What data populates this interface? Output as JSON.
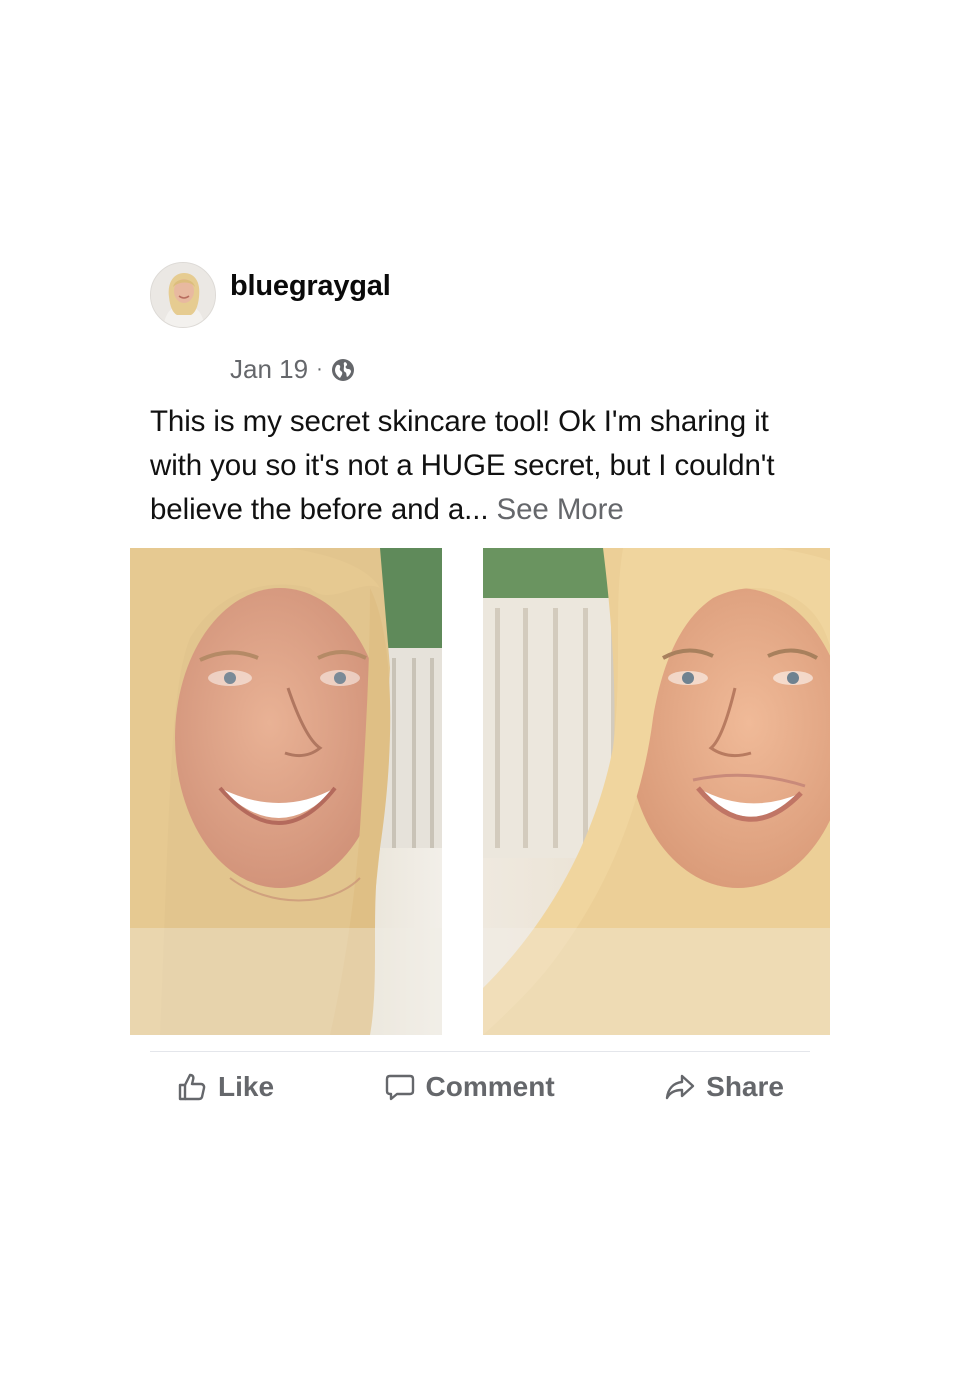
{
  "post": {
    "author": "bluegraygal",
    "date": "Jan 19",
    "separator": "·",
    "privacy_icon": "globe-icon",
    "text_body": "This is my secret skincare tool! Ok I'm sharing it with you so it's not a HUGE secret, but I couldn't believe the before and a...",
    "see_more": "See More",
    "photos": [
      {
        "name": "before-photo"
      },
      {
        "name": "after-photo"
      }
    ]
  },
  "actions": {
    "like_label": "Like",
    "comment_label": "Comment",
    "share_label": "Share"
  },
  "colors": {
    "meta_gray": "#65676b",
    "text": "#111111",
    "divider": "#e4e6eb"
  }
}
